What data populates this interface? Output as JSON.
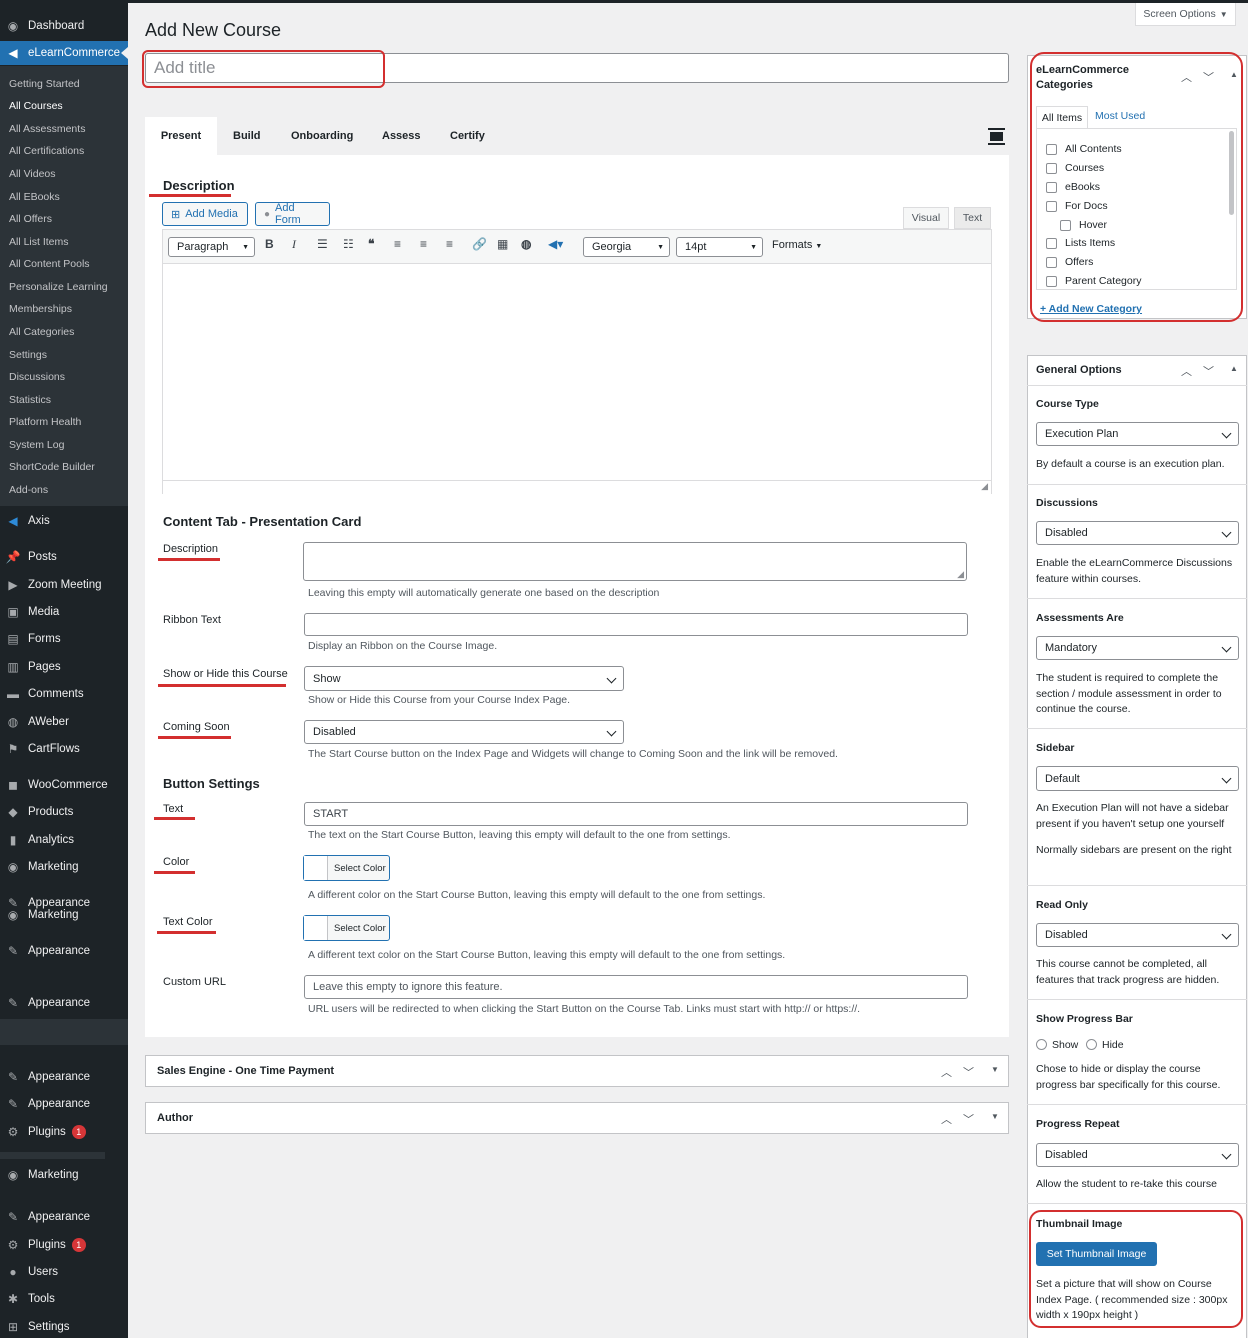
{
  "sidebar": {
    "top_items": [
      {
        "label": "Dashboard",
        "icon": "dashboard-icon"
      },
      {
        "label": "eLearnCommerce",
        "icon": "elearncommerce-icon"
      }
    ],
    "submenu": [
      "Getting Started",
      "All Courses",
      "All Assessments",
      "All Certifications",
      "All Videos",
      "All EBooks",
      "All Offers",
      "All List Items",
      "All Content Pools",
      "Personalize Learning",
      "Memberships",
      "All Categories",
      "Settings",
      "Discussions",
      "Statistics",
      "Platform Health",
      "System Log",
      "ShortCode Builder",
      "Add-ons"
    ],
    "items": [
      {
        "label": "Axis",
        "icon": "axis-icon"
      },
      {
        "label": "Posts",
        "icon": "pin-icon"
      },
      {
        "label": "Zoom Meeting",
        "icon": "video-icon"
      },
      {
        "label": "Media",
        "icon": "media-icon"
      },
      {
        "label": "Forms",
        "icon": "forms-icon"
      },
      {
        "label": "Pages",
        "icon": "pages-icon"
      },
      {
        "label": "Comments",
        "icon": "comment-icon"
      },
      {
        "label": "AWeber",
        "icon": "aweber-icon"
      },
      {
        "label": "CartFlows",
        "icon": "cartflows-icon"
      },
      {
        "label": "WooCommerce",
        "icon": "woocommerce-icon"
      },
      {
        "label": "Products",
        "icon": "products-icon"
      },
      {
        "label": "Analytics",
        "icon": "analytics-icon"
      },
      {
        "label": "Marketing",
        "icon": "marketing-icon"
      },
      {
        "label": "Appearance",
        "icon": "appearance-icon"
      },
      {
        "label": "Marketing",
        "icon": "marketing-icon"
      },
      {
        "label": "Appearance",
        "icon": "appearance-icon"
      },
      {
        "label": "Appearance",
        "icon": "appearance-icon"
      },
      {
        "label": "Appearance",
        "icon": "appearance-icon"
      },
      {
        "label": "Appearance",
        "icon": "appearance-icon"
      },
      {
        "label": "Plugins",
        "icon": "plugins-icon",
        "badge": "1"
      },
      {
        "label": "Marketing",
        "icon": "marketing-icon"
      },
      {
        "label": "Appearance",
        "icon": "appearance-icon"
      },
      {
        "label": "Plugins",
        "icon": "plugins-icon",
        "badge": "1"
      },
      {
        "label": "Users",
        "icon": "users-icon"
      },
      {
        "label": "Tools",
        "icon": "tools-icon"
      },
      {
        "label": "Settings",
        "icon": "settings-icon"
      }
    ]
  },
  "header": {
    "screen_options": "Screen Options",
    "page_title": "Add New Course",
    "title_placeholder": "Add title"
  },
  "tabs": [
    "Present",
    "Build",
    "Onboarding",
    "Assess",
    "Certify"
  ],
  "editor": {
    "section_title": "Description",
    "add_media": "Add Media",
    "add_form": "Add Form",
    "visual_tab": "Visual",
    "text_tab": "Text",
    "format_select": "Paragraph",
    "font_select": "Georgia",
    "size_select": "14pt",
    "formats_menu": "Formats"
  },
  "presentation": {
    "heading": "Content Tab - Presentation Card",
    "description_label": "Description",
    "description_help": "Leaving this empty will automatically generate one based on the description",
    "ribbon_label": "Ribbon Text",
    "ribbon_help": "Display an Ribbon on the Course Image.",
    "showhide_label": "Show or Hide this Course",
    "showhide_value": "Show",
    "showhide_help": "Show or Hide this Course from your Course Index Page.",
    "coming_label": "Coming Soon",
    "coming_value": "Disabled",
    "coming_help": "The Start Course button on the Index Page and Widgets will change to Coming Soon and the link will be removed."
  },
  "button_settings": {
    "heading": "Button Settings",
    "text_label": "Text",
    "text_value": "START",
    "text_help": "The text on the Start Course Button, leaving this empty will default to the one from settings.",
    "color_label": "Color",
    "select_color": "Select Color",
    "color_help": "A different color on the Start Course Button, leaving this empty will default to the one from settings.",
    "textcolor_label": "Text Color",
    "textcolor_help": "A different text color on the Start Course Button, leaving this empty will default to the one from settings.",
    "url_label": "Custom URL",
    "url_placeholder": "Leave this empty to ignore this feature.",
    "url_help": "URL users will be redirected to when clicking the Start Button on the Course Tab. Links must start with http:// or https://."
  },
  "boxes": {
    "sales": "Sales Engine - One Time Payment",
    "author": "Author"
  },
  "categories": {
    "title_line1": "eLearnCommerce",
    "title_line2": "Categories",
    "tab_all": "All Items",
    "tab_most": "Most Used",
    "items": [
      "All Contents",
      "Courses",
      "eBooks",
      "For Docs",
      "Hover",
      "Lists Items",
      "Offers",
      "Parent Category"
    ],
    "add_new": "+ Add New Category"
  },
  "general": {
    "title": "General Options",
    "course_type_label": "Course Type",
    "course_type_value": "Execution Plan",
    "course_type_help": "By default a course is an execution plan.",
    "discussions_label": "Discussions",
    "discussions_value": "Disabled",
    "discussions_help": "Enable the eLearnCommerce Discussions feature within courses.",
    "assessments_label": "Assessments Are",
    "assessments_value": "Mandatory",
    "assessments_help": "The student is required to complete the section / module assessment in order to continue the course.",
    "sidebar_label": "Sidebar",
    "sidebar_value": "Default",
    "sidebar_help1": "An Execution Plan will not have a sidebar present if you haven't setup one yourself",
    "sidebar_help2": "Normally sidebars are present on the right",
    "readonly_label": "Read Only",
    "readonly_value": "Disabled",
    "readonly_help": "This course cannot be completed, all features that track progress are hidden.",
    "progressbar_label": "Show Progress Bar",
    "progress_show": "Show",
    "progress_hide": "Hide",
    "progressbar_help": "Chose to hide or display the course progress bar specifically for this course.",
    "repeat_label": "Progress Repeat",
    "repeat_value": "Disabled",
    "repeat_help": "Allow the student to re-take this course",
    "thumb_label": "Thumbnail Image",
    "thumb_button": "Set Thumbnail Image",
    "thumb_help": "Set a picture that will show on Course Index Page. ( recommended size : 300px width x 190px height )"
  },
  "colors": {
    "accent": "#2271b1",
    "annotation": "#d32f2f",
    "sidebar_bg": "#1d2327"
  }
}
